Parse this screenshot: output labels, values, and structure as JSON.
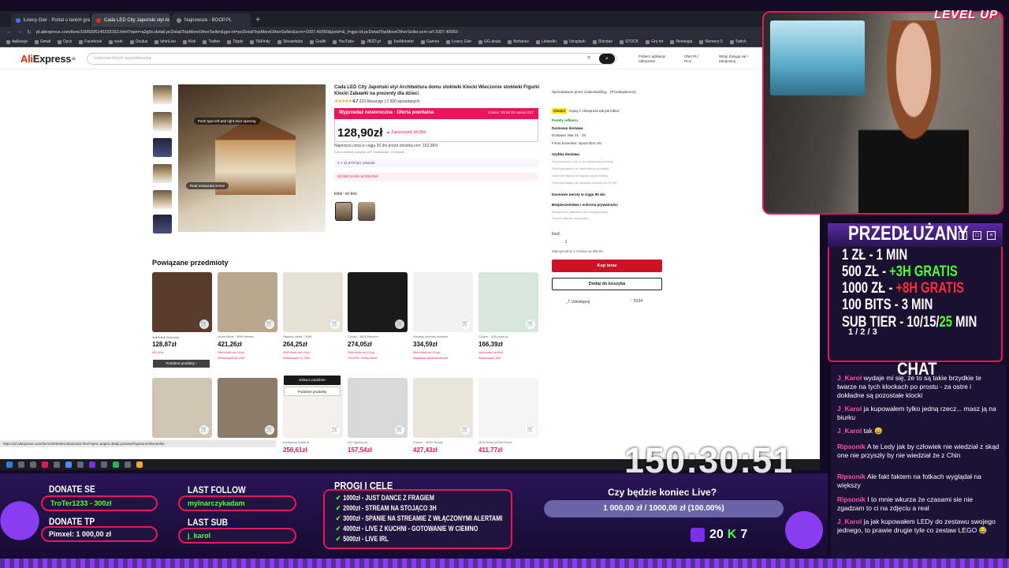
{
  "browser": {
    "tabs": [
      {
        "label": "Łowcy Gier - Portal o tanich grach",
        "active": false,
        "color": "#3b7bf0"
      },
      {
        "label": "Cada LED City Japoński styl Ar...",
        "active": true,
        "color": "#e62e04"
      },
      {
        "label": "Najnowsze - BOOP.PL",
        "active": false,
        "color": "#888888"
      }
    ],
    "new_tab": "+",
    "url": "pl.aliexpress.com/item/1005006145333162.html?spm=a2g0o.detail.pcDetailTopMoreOtherSeller&gps-id=pcDetailTopMoreOtherSeller&scm=1007.40050&pvid=&_t=gps-id:pcDetailTopMoreOtherSeller,scm-url:1007.40050",
    "bookmarks": [
      "Aplikacje",
      "Gmail",
      "Dyck",
      "Facebook",
      "work",
      "Oculus",
      "IshinLive",
      "Kick",
      "Twitter",
      "Tipply",
      "TikFinity",
      "Streamlabs",
      "Grafik",
      "YouTube",
      "JBZD.pl",
      "JoeMonster",
      "Games",
      "Łowcy Gier",
      "GG.deals",
      "Behance",
      "LinkedIn",
      "Unsplash",
      "Shindan",
      "STOCK",
      "Gry tnt",
      "Norwegia",
      "Memory 5",
      "Twitch"
    ],
    "status_url": "https://pl.aliexpress.com/item/1005006145333162.html?spm=a2g0o.detail.pcDetailTopMoreOtherSeller"
  },
  "ae": {
    "logo_a": "Ali",
    "logo_b": "Express",
    "search_placeholder": "kolorowe klocki wyszukiwarka",
    "download_app": "Pobierz aplikację AliExpress",
    "ship_to": "Ofert PL/ PLN",
    "account": "Witaj! Zaloguj się / Zarejestruj"
  },
  "product": {
    "title": "Cada LED City Japoński styl Architektura domu stołówki Klocki Wieczorne stołówki Figurki Klocki Zabawki na prezenty dla dzieci",
    "stars": "★★★★★",
    "rating": "4.7",
    "reviews": "223 Recenzje  |  2 000 sprzedanych",
    "sale_label": "Wyprzedaż noworoczna · Oferta powitalna",
    "sale_ends": "Koniec:  23:59 29 marca CET",
    "price": "128,90zł",
    "old_price": "▲ Zaoszczędź 34,08zł",
    "lowest": "Najniższa cena w ciągu 30 dni przed obniżką cen: 162,98zł",
    "tax": "Cena zawiera podatek VAT. Dodatkowe 1% rabatu",
    "coupon1": "3 × 42,97zł bez odsetek",
    "coupon2": "18,00zł zniżki na 108,00zł",
    "color_label": "kolor: no box",
    "img_tag1": "Push type left and right door opening",
    "img_tag2": "Real restaurant scene"
  },
  "panel": {
    "seller": "Sprzedawane przez  Cada Building...  (Przedsiębiorca)",
    "choice": "Choice",
    "choice_text": "Kupuj z Aliexpress tak jak lubisz",
    "points": "Punkty odbioru",
    "free_delivery": "Darmowa dostawa",
    "delivery_date": "Dostawa: Mar 21 - 25",
    "couriers": "Firma kurierska:  Inpost  DHL  etc.",
    "fast_delivery": "Szybka dostawa",
    "fast1": "Koszt kuponu 4,00 zł za opóźnioną dostawę",
    "fast2": "Zwrot pieniędzy za uszkodzone produkty",
    "fast3": "Zwrot pieniędzy za zagubioną przesyłkę",
    "fast4": "Zwrot pieniędzy za dostawę dłuższą niż 50 dni",
    "returns": "Darmowe zwroty w ciągu 90 dni",
    "security": "Bezpieczeństwo i ochrona prywatności",
    "sec1": "Bezpieczne płatności: nie udostępniamy",
    "sec2": "Twoich danych osobowych",
    "qty_label": "Ilość",
    "qty": "1",
    "qty_note": "Maksymalnie 1 sztuka na klienta",
    "buy": "Kup teraz",
    "add_cart": "Dodaj do koszyka",
    "share": "Udostępnij",
    "likes": "9134"
  },
  "related": {
    "title": "Powiązane przedmioty",
    "similar": "Podobne produkty  ›",
    "overlay_btn1": "Zobacz podobne",
    "overlay_btn2": "Podobne produkty",
    "row1": [
      {
        "price": "128,87zł",
        "meta": "★★★★★ Bestseller",
        "meta2": "367,82zł",
        "bg": "#5a3c2c"
      },
      {
        "price": "421,26zł",
        "meta": "Home Alone · 3959 elemen",
        "meta2": "25zł zniżki na 1 Kup",
        "meta3": "Zaoszczędź 63,22zł",
        "bg": "#b9a88d"
      },
      {
        "price": "264,25zł",
        "meta": "Świetna oferta · 3268",
        "meta2": "25zł zniżki na 1 Kup",
        "meta3": "Zaoszczędź 12,25zł",
        "bg": "#e6e0d5"
      },
      {
        "price": "274,05zł",
        "meta": "Choice · 3893 Element",
        "meta2": "25zł zniżki na 1 Kup",
        "meta3": "-30,49% · Nowy klient",
        "bg": "#1a1a1a"
      },
      {
        "price": "334,59zł",
        "meta": "Zestawy klocków konstruk",
        "meta2": "25zł zniżki na 1 Kup",
        "meta3": "Najniższa cena wśród pod",
        "bg": "#f2f2f2"
      },
      {
        "price": "166,39zł",
        "meta": "Choice · 1108 sztuk ja",
        "meta2": "18zł zniżki na 89zł",
        "meta3": "Zaoszczędź 11zł",
        "bg": "#d7e7dd"
      }
    ],
    "row2": [
      {
        "price": "",
        "meta": "Japońska Ku",
        "bg": "#cfc5b3"
      },
      {
        "price": "",
        "meta": "",
        "bg": "#8a7c67"
      },
      {
        "price": "256,61zł",
        "meta": "Kreatywny model ar",
        "bg": "#f3f0ec"
      },
      {
        "price": "157,54zł",
        "meta": "DIY Zgodny ze",
        "bg": "#d8d8d8"
      },
      {
        "price": "427,43zł",
        "meta": "Choice · 76457 Kreaty",
        "bg": "#e9e3da"
      },
      {
        "price": "411,77zł",
        "meta": "2026 Nowy 42208 Techni",
        "bg": "#f5f5f5"
      }
    ]
  },
  "stream": {
    "levelup": "LEVEL UP",
    "extended": "PRZEDŁUŻANY",
    "rows": [
      {
        "left": "1 ZŁ",
        "mid": "- 1 MIN",
        "extra": "",
        "cls": ""
      },
      {
        "left": "500 ZŁ",
        "mid": "- ",
        "extra": "+3H GRATIS",
        "cls": "g"
      },
      {
        "left": "1000 ZŁ",
        "mid": "- ",
        "extra": "+8H GRATIS",
        "cls": "r"
      },
      {
        "left": "100 BITS",
        "mid": "- 3 MIN",
        "extra": "",
        "cls": ""
      },
      {
        "left": "SUB TIER",
        "mid": "- 10/15/",
        "extra": "25",
        "cls": "g",
        "tail": " MIN"
      }
    ],
    "subtier_small": "1 / 2 / 3",
    "chat_title": "CHAT",
    "chat": [
      {
        "user": "J_Karol",
        "text": "wydaje mi się, że to są takie brzydkie te twarze na tych klockach po prostu - za ostre i dokładne są pozostałe klocki"
      },
      {
        "user": "J_Karol",
        "text": "ja kupowałem tylko jedną rzecz... masz ją na biurku"
      },
      {
        "user": "J_Karol",
        "text": "tak 😄"
      },
      {
        "user": "Ripsonik",
        "text": "A te Ledy jak by człowiek nie wiedział z skąd one nie przyszły by nie wiedział że z Chin"
      },
      {
        "user": "Ripsonik",
        "text": "Ale fakt faktem na fotkach wyglądał na większy"
      },
      {
        "user": "Ripsonik",
        "text": "I to mnie wkurza że czasami sie nie zgadzam to ci na zdjęciu a real"
      },
      {
        "user": "J_Karol",
        "text": "ja jak kupowałem LEDy do zestawu swojego jednego, to prawie drugie tyle co zestaw LEGO 😂"
      }
    ],
    "timer": "150:30:51",
    "donate_se_label": "DONATE SE",
    "donate_se_value": "TroTer1233 - 300zł",
    "donate_tp_label": "DONATE TP",
    "donate_tp_value": "Pimxel: 1 000,00 zł",
    "last_follow_label": "LAST FOLLOW",
    "last_follow_value": "mylnarczykadam",
    "last_sub_label": "LAST SUB",
    "last_sub_value": "j_karol",
    "goals_title": "PROGI I CELE",
    "goals": [
      "1000zł - JUST DANCE Z FRAGIEM",
      "2000zł - STREAM NA STOJĄCO 3H",
      "3000zł - SPANIE NA STREAMIE Z WŁĄCZONYMI ALERTAMI",
      "4000zł - LIVE Z KUCHNI - GOTOWANIE W CIEMNO",
      "5000zł - LIVE IRL"
    ],
    "poll_question": "Czy będzie koniec Live?",
    "poll_value": "1 000,00 zł / 1000,00 zł (100.00%)",
    "viewers_twitch": "20",
    "viewers_kick_letter": "K",
    "viewers_kick": "7"
  }
}
